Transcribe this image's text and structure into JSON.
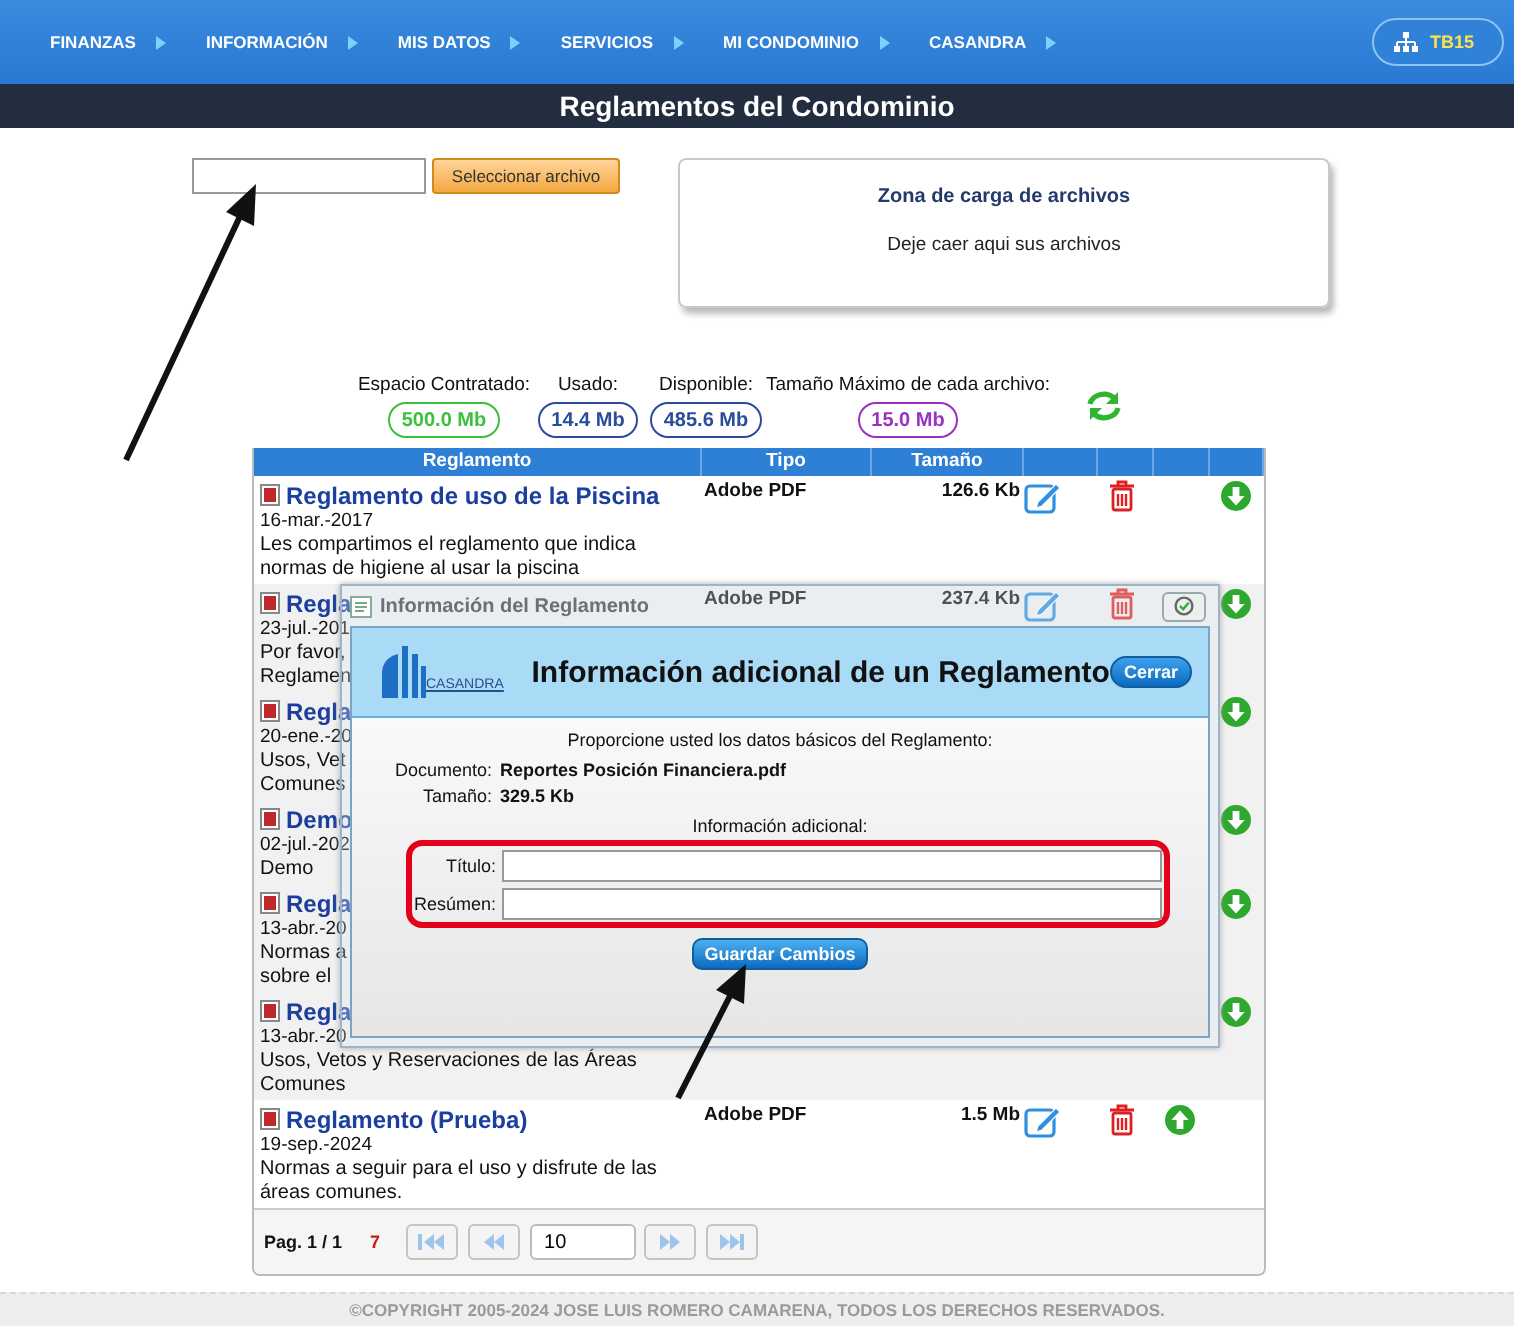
{
  "nav": {
    "items": [
      "FINANZAS",
      "INFORMACIÓN",
      "MIS DATOS",
      "SERVICIOS",
      "MI CONDOMINIO",
      "CASANDRA"
    ],
    "user": "TB15"
  },
  "title": "Reglamentos del Condominio",
  "upload": {
    "button": "Seleccionar archivo",
    "dropzone": {
      "title": "Zona de carga de archivos",
      "hint": "Deje caer aqui sus archivos"
    }
  },
  "storage": [
    {
      "label": "Espacio Contratado:",
      "value": "500.0 Mb",
      "color": "#3cbf3c"
    },
    {
      "label": "Usado:",
      "value": "14.4 Mb",
      "color": "#2b4c9c"
    },
    {
      "label": "Disponible:",
      "value": "485.6 Mb",
      "color": "#2b4c9c"
    },
    {
      "label": "Tamaño Máximo de cada archivo:",
      "value": "15.0 Mb",
      "color": "#9b30c4"
    }
  ],
  "table": {
    "columns": [
      "Reglamento",
      "Tipo",
      "Tamaño"
    ],
    "rows": [
      {
        "title": "Reglamento de uso de la Piscina",
        "date": "16-mar.-2017",
        "description": [
          "Les compartimos el reglamento que indica",
          "normas de higiene al usar la piscina"
        ],
        "type": "Adobe PDF",
        "size": "126.6 Kb",
        "shaded": false,
        "actions": [
          {
            "kind": "edit"
          },
          {
            "kind": "delete"
          },
          {
            "kind": "download"
          }
        ]
      },
      {
        "title": "Regla",
        "date": "23-jul.-201",
        "description": [
          "Por favor,",
          "Reglamen"
        ],
        "type": "Adobe PDF",
        "size": "237.4 Kb",
        "shaded": true,
        "actions": [
          {
            "kind": "edit"
          },
          {
            "kind": "delete"
          },
          {
            "kind": "download"
          }
        ]
      },
      {
        "title": "Regla",
        "date": "20-ene.-20",
        "description": [
          "Usos, Vet",
          "Comunes"
        ],
        "shaded": true,
        "actions": [
          {
            "kind": "download"
          }
        ]
      },
      {
        "title": "Demo",
        "date": "02-jul.-202",
        "description": [
          "Demo"
        ],
        "shaded": true,
        "actions": [
          {
            "kind": "download"
          }
        ]
      },
      {
        "title": "Regla",
        "date": "13-abr.-20",
        "description": [
          "Normas a",
          "sobre el"
        ],
        "shaded": true,
        "actions": [
          {
            "kind": "download"
          }
        ]
      },
      {
        "title": "Regla",
        "date": "13-abr.-20",
        "description": [
          "Usos, Vetos y Reservaciones de las Áreas",
          "Comunes"
        ],
        "shaded": true,
        "actions": [
          {
            "kind": "download"
          }
        ]
      },
      {
        "title": "Reglamento (Prueba)",
        "date": "19-sep.-2024",
        "description": [
          "Normas a seguir para el uso y disfrute de las",
          "áreas comunes."
        ],
        "type": "Adobe PDF",
        "size": "1.5 Mb",
        "shaded": false,
        "actions": [
          {
            "kind": "edit"
          },
          {
            "kind": "delete"
          },
          {
            "kind": "upload"
          }
        ]
      }
    ]
  },
  "pager": {
    "page": "Pag. 1 / 1",
    "count": "7",
    "buttons_before": [
      {
        "kind": "first"
      },
      {
        "kind": "prev"
      }
    ],
    "page_size": "10",
    "buttons_after": [
      {
        "kind": "next"
      },
      {
        "kind": "last"
      }
    ]
  },
  "modal": {
    "window_title": "Información del Reglamento",
    "logo": "CASANDRA",
    "heading": "Información adicional de un Reglamento",
    "close": "Cerrar",
    "intro": "Proporcione usted los datos básicos del Reglamento:",
    "details": [
      {
        "label": "Documento:",
        "value": "Reportes Posición Financiera.pdf"
      },
      {
        "label": "Tamaño:",
        "value": "329.5 Kb"
      }
    ],
    "section": "Información adicional:",
    "fields": [
      {
        "label": "Título:"
      },
      {
        "label": "Resúmen:"
      }
    ],
    "save": "Guardar Cambios"
  },
  "footer": "©COPYRIGHT 2005-2024 JOSE LUIS ROMERO CAMARENA, TODOS LOS DERECHOS RESERVADOS."
}
